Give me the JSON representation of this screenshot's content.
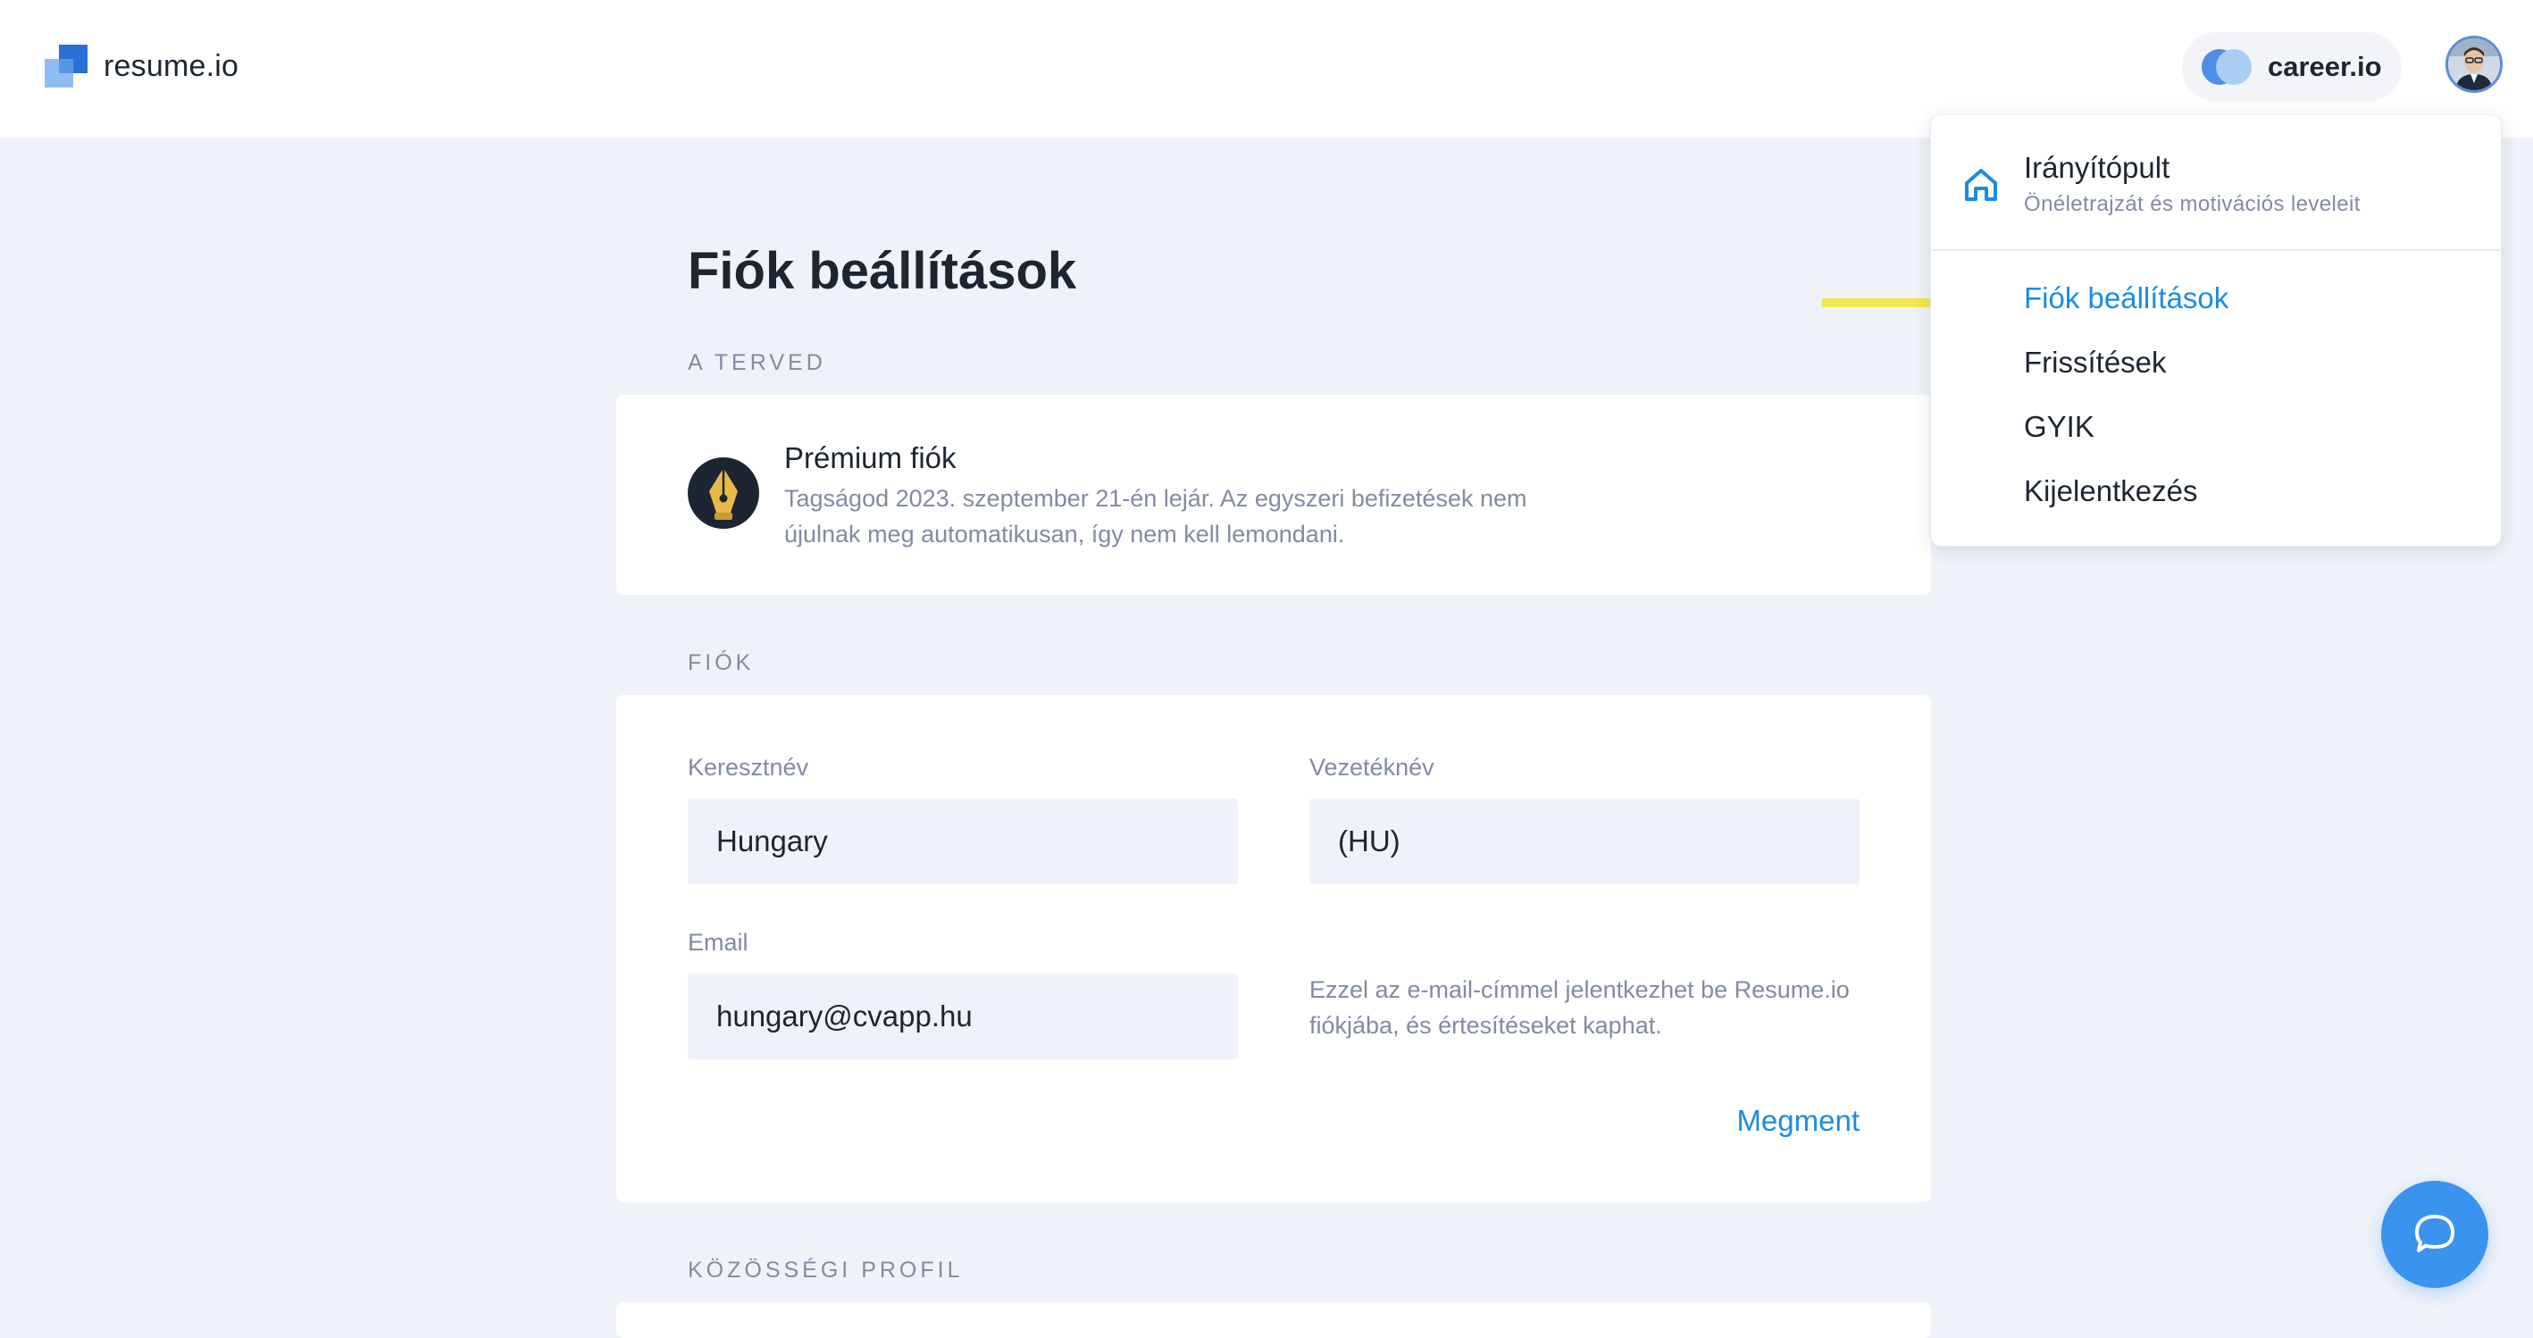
{
  "header": {
    "brand": "resume.io",
    "partner_label": "career.io",
    "avatar_alt": "user avatar"
  },
  "page": {
    "title": "Fiók beállítások"
  },
  "plan_section": {
    "label": "A TERVED",
    "plan_name": "Prémium fiók",
    "plan_description": "Tagságod 2023. szeptember 21-én lejár. Az egyszeri befizetések nem újulnak meg automatikusan, így nem kell lemondani."
  },
  "account_section": {
    "label": "FIÓK",
    "first_name_label": "Keresztnév",
    "first_name_value": "Hungary",
    "last_name_label": "Vezetéknév",
    "last_name_value": "(HU)",
    "email_label": "Email",
    "email_value": "hungary@cvapp.hu",
    "email_hint": "Ezzel az e-mail-címmel jelentkezhet be Resume.io fiókjába, és értesítéseket kaphat.",
    "save_label": "Megment"
  },
  "social_section": {
    "label": "KÖZÖSSÉGI PROFIL"
  },
  "dropdown_menu": {
    "dashboard_title": "Irányítópult",
    "dashboard_subtitle": "Önéletrajzát és motivációs leveleit",
    "items": [
      {
        "label": "Fiók beállítások",
        "active": true
      },
      {
        "label": "Frissítések",
        "active": false
      },
      {
        "label": "GYIK",
        "active": false
      },
      {
        "label": "Kijelentkezés",
        "active": false
      }
    ]
  },
  "icons": {
    "logo": "resume-logo-icon",
    "partner": "career-io-icon",
    "plan": "fountain-pen-icon",
    "dashboard": "home-icon",
    "pointer": "arrow-right-icon",
    "chat": "chat-bubble-icon"
  },
  "colors": {
    "accent": "#1a8ce6",
    "brand_blue": "#4f8de8",
    "pointer_arrow": "#f2e84b",
    "page_background": "#eff2f9",
    "chat_button": "#3b93f0"
  }
}
